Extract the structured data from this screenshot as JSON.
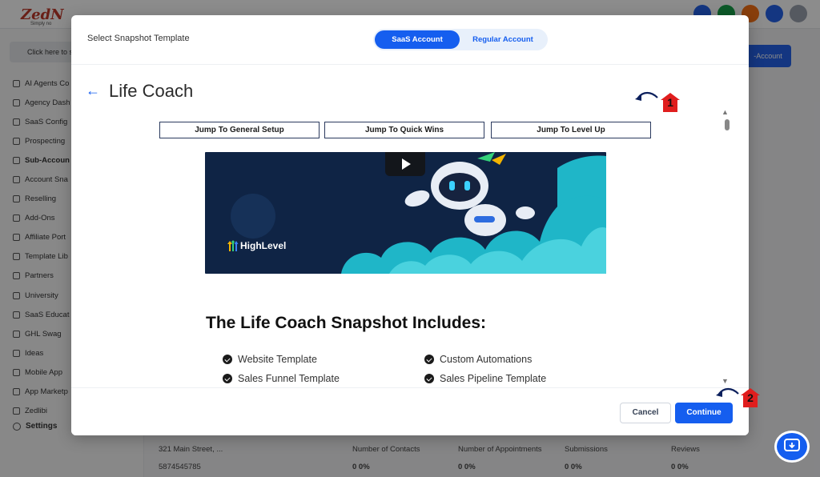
{
  "background_app": {
    "logo_text": "ZedN",
    "logo_sub": "Simply no",
    "search_text": "Click here to s",
    "nav_items": [
      {
        "label": "AI Agents Co",
        "active": false
      },
      {
        "label": "Agency Dash",
        "active": false
      },
      {
        "label": "SaaS Config",
        "active": false
      },
      {
        "label": "Prospecting",
        "active": false
      },
      {
        "label": "Sub-Accoun",
        "active": true
      },
      {
        "label": "Account Sna",
        "active": false
      },
      {
        "label": "Reselling",
        "active": false
      },
      {
        "label": "Add-Ons",
        "active": false
      },
      {
        "label": "Affiliate Port",
        "active": false
      },
      {
        "label": "Template Lib",
        "active": false
      },
      {
        "label": "Partners",
        "active": false
      },
      {
        "label": "University",
        "active": false
      },
      {
        "label": "SaaS Educat",
        "active": false
      },
      {
        "label": "GHL Swag",
        "active": false
      },
      {
        "label": "Ideas",
        "active": false
      },
      {
        "label": "Mobile App",
        "active": false
      },
      {
        "label": "App Marketp",
        "active": false
      },
      {
        "label": "Zedlibi",
        "active": false
      }
    ],
    "settings_label": "Settings",
    "main_button": "-Account",
    "bottom_row": {
      "address": "321 Main Street, ...",
      "phone": "5874545785",
      "contacts_label": "Number of Contacts",
      "contacts_value": "0  0%",
      "appointments_label": "Number of Appointments",
      "appointments_value": "0  0%",
      "submissions_label": "Submissions",
      "submissions_value": "0  0%",
      "reviews_label": "Reviews",
      "reviews_value": "0  0%"
    }
  },
  "modal": {
    "title": "Select Snapshot Template",
    "toggle": {
      "saas_label": "SaaS Account",
      "regular_label": "Regular Account",
      "selected": "saas"
    },
    "template_name": "Life Coach",
    "jump_buttons": [
      {
        "label": "Jump To General Setup"
      },
      {
        "label": "Jump To Quick Wins"
      },
      {
        "label": "Jump To Level Up"
      }
    ],
    "video": {
      "brand": "HighLevel"
    },
    "includes_heading": "The Life Coach Snapshot Includes:",
    "includes_items": [
      {
        "label": "Website Template"
      },
      {
        "label": "Custom Automations"
      },
      {
        "label": "Sales Funnel Template"
      },
      {
        "label": "Sales Pipeline Template"
      }
    ],
    "footer": {
      "cancel_label": "Cancel",
      "continue_label": "Continue"
    }
  },
  "annotations": [
    {
      "number": "1"
    },
    {
      "number": "2"
    }
  ],
  "colors": {
    "primary": "#155eef",
    "marker_red": "#e01e1e",
    "video_bg": "#0f2445",
    "video_cloud": "#1fb6c8"
  }
}
